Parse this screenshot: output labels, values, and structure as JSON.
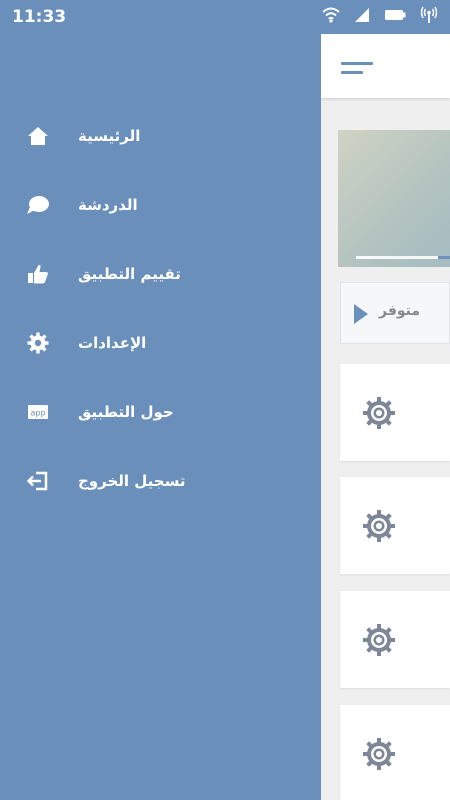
{
  "status_bar": {
    "time": "11:33",
    "icons": [
      "wifi-icon",
      "signal-icon",
      "battery-icon",
      "hotspot-icon"
    ]
  },
  "drawer": {
    "items": [
      {
        "label": "الرئيسية",
        "icon": "home-icon"
      },
      {
        "label": "الدردشة",
        "icon": "chat-icon"
      },
      {
        "label": "تقييم التطبيق",
        "icon": "thumbs-up-icon"
      },
      {
        "label": "الإعدادات",
        "icon": "gear-icon"
      },
      {
        "label": "حول التطبيق",
        "icon": "app-icon"
      },
      {
        "label": "تسجيل الخروج",
        "icon": "logout-icon"
      }
    ]
  },
  "main": {
    "toolbar_icon": "menu-icon",
    "availability": {
      "label": "متوفر",
      "icon": "play-icon"
    },
    "list_cards": [
      {
        "icon": "gear-icon"
      },
      {
        "icon": "gear-icon"
      },
      {
        "icon": "gear-icon"
      },
      {
        "icon": "gear-icon"
      }
    ]
  },
  "colors": {
    "drawer_bg": "#6a8fba",
    "text_on_drawer": "#ffffff",
    "accent": "#6a8fba",
    "gear_gray": "#7d8797"
  }
}
